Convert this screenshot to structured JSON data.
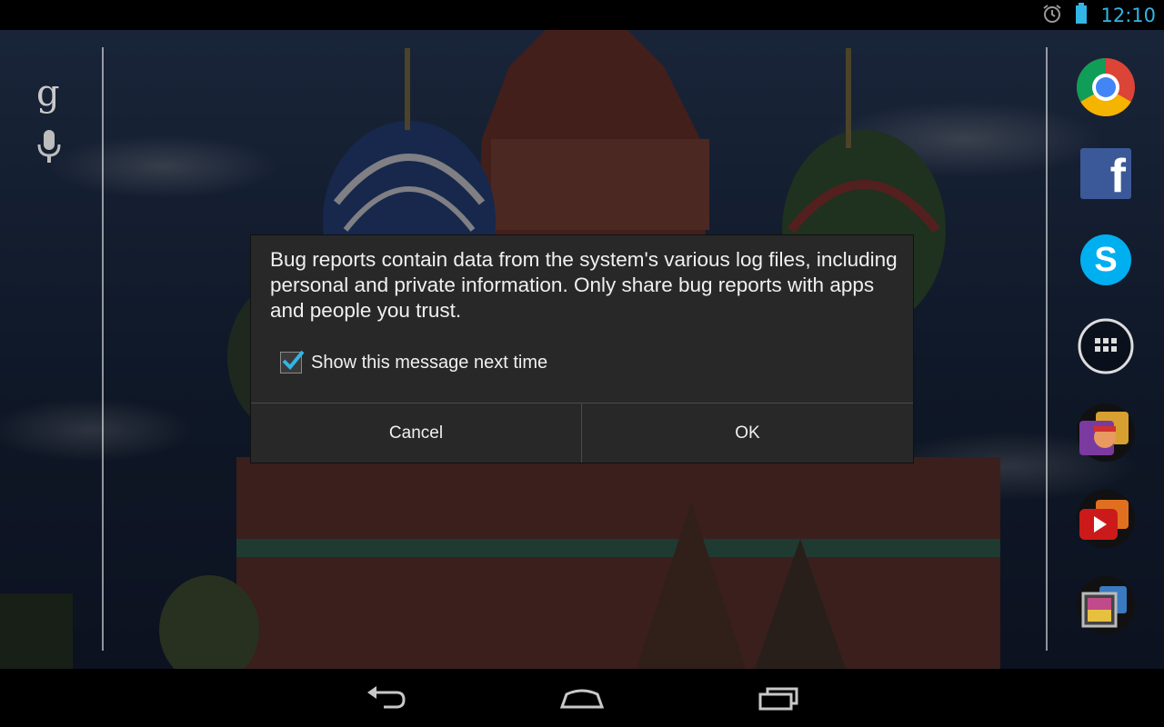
{
  "status_bar": {
    "time": "12:10",
    "icons": [
      "alarm-icon",
      "battery-icon"
    ]
  },
  "search": {
    "google_glyph": "g",
    "icons": [
      "google-search-icon",
      "voice-search-icon"
    ]
  },
  "dock": {
    "apps": [
      "chrome-icon",
      "facebook-icon",
      "skype-icon",
      "all-apps-icon",
      "games-folder-icon",
      "media-folder-icon",
      "gallery-folder-icon"
    ],
    "facebook_glyph": "f",
    "skype_glyph": "S"
  },
  "dialog": {
    "message": "Bug reports contain data from the system's various log files, including personal and private information. Only share bug reports with apps and people you trust.",
    "checkbox_label": "Show this message next time",
    "checkbox_checked": true,
    "cancel_label": "Cancel",
    "ok_label": "OK"
  },
  "nav": {
    "buttons": [
      "back-icon",
      "home-icon",
      "recents-icon"
    ]
  },
  "colors": {
    "accent": "#33b5e5",
    "dialog_bg": "#282828",
    "navbar_bg": "#000000"
  }
}
